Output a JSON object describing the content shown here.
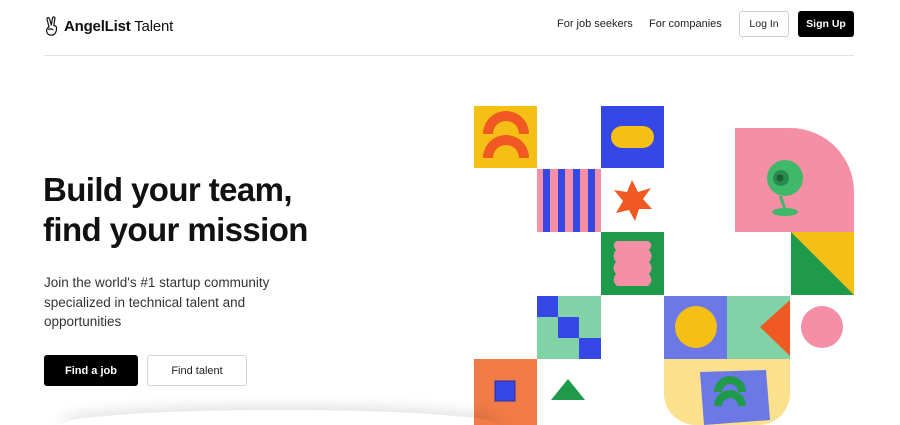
{
  "header": {
    "logo_text_bold": "AngelList",
    "logo_text": "Talent",
    "nav": [
      {
        "label": "For job seekers"
      },
      {
        "label": "For companies"
      }
    ],
    "login_label": "Log In",
    "signup_label": "Sign Up"
  },
  "hero": {
    "title_line1": "Build your team,",
    "title_line2": "find your mission",
    "subtitle": "Join the world's #1 startup community specialized in technical talent and opportunities",
    "primary_cta": "Find a job",
    "secondary_cta": "Find talent"
  },
  "icons": {
    "logo": "victory-hand-icon"
  },
  "colors": {
    "yellow": "#F6BF16",
    "orange": "#F05A22",
    "blue": "#3547E5",
    "pink": "#F48FA6",
    "green": "#1F9A4B",
    "mint": "#7FD3A6",
    "peach": "#F07B46",
    "periwinkle": "#6B78E6",
    "light_yellow": "#FBE08D"
  }
}
